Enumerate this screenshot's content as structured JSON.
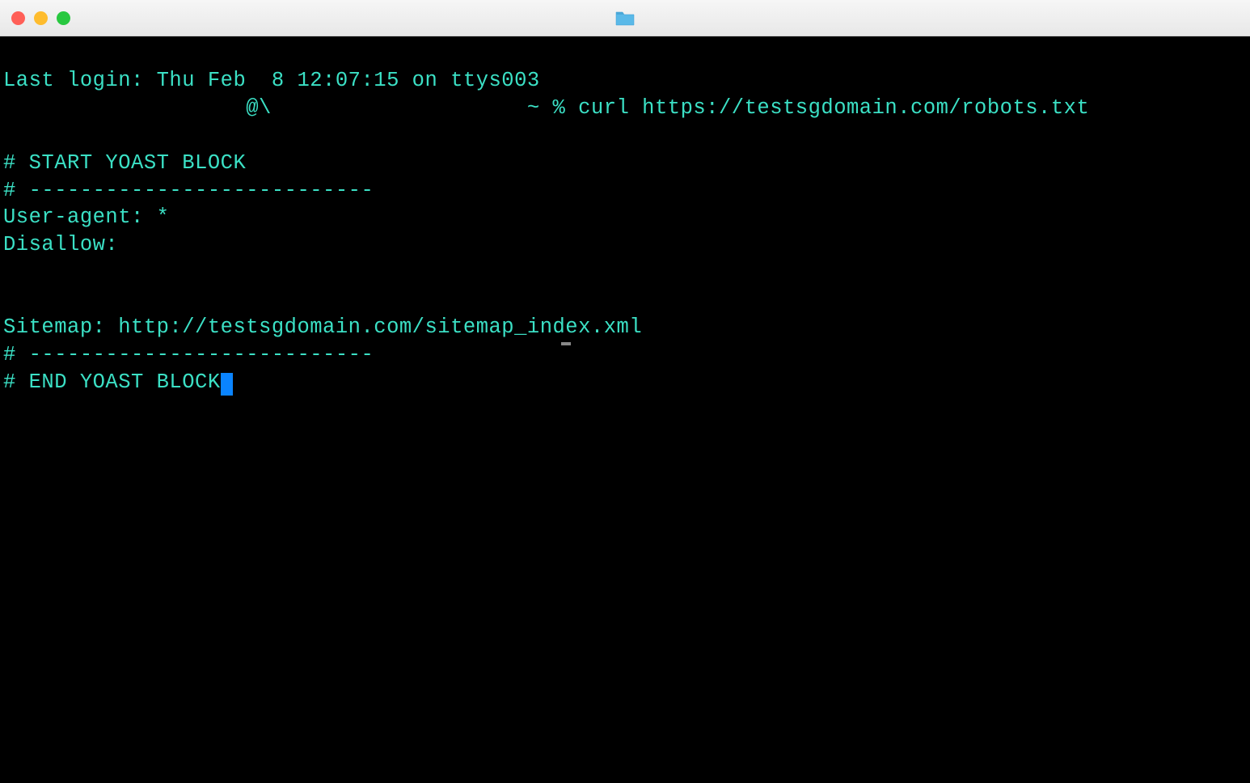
{
  "titlebar": {
    "close_label": "close",
    "min_label": "minimize",
    "max_label": "maximize",
    "folder_label": "folder"
  },
  "terminal": {
    "last_login": "Last login: Thu Feb  8 12:07:15 on ttys003",
    "user_host": "@\\",
    "prompt_path": "~ %",
    "command": "curl https://testsgdomain.com/robots.txt",
    "output": {
      "line1": "# START YOAST BLOCK",
      "line2": "# ---------------------------",
      "line3": "User-agent: *",
      "line4": "Disallow:",
      "line5": "",
      "line6": "",
      "line7": "Sitemap: http://testsgdomain.com/sitemap_index.xml",
      "line8": "# ---------------------------",
      "line9": "# END YOAST BLOCK"
    }
  }
}
